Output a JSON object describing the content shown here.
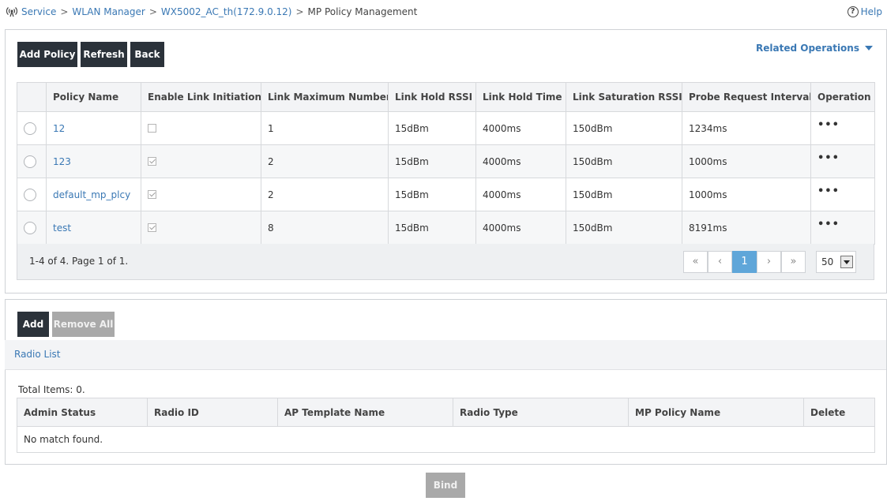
{
  "breadcrumb": {
    "items": [
      "Service",
      "WLAN Manager",
      "WX5002_AC_th(172.9.0.12)"
    ],
    "separator": ">",
    "current": "MP Policy Management"
  },
  "help": {
    "label": "Help",
    "icon": "help-circle-icon"
  },
  "toolbar": {
    "add_policy": "Add Policy",
    "refresh": "Refresh",
    "back": "Back"
  },
  "related_operations": {
    "label": "Related Operations",
    "icon": "triangle-down-icon"
  },
  "policy_table": {
    "headers": [
      "Policy Name",
      "Enable Link Initiation",
      "Link Maximum Number",
      "Link Hold RSSI",
      "Link Hold Time",
      "Link Saturation RSSI",
      "Probe Request Interval",
      "Operation"
    ],
    "rows": [
      {
        "name": "12",
        "enabled": false,
        "max": "1",
        "hold_rssi": "15dBm",
        "hold_time": "4000ms",
        "sat_rssi": "150dBm",
        "probe": "1234ms",
        "op": "•••"
      },
      {
        "name": "123",
        "enabled": true,
        "max": "2",
        "hold_rssi": "15dBm",
        "hold_time": "4000ms",
        "sat_rssi": "150dBm",
        "probe": "1000ms",
        "op": "•••"
      },
      {
        "name": "default_mp_plcy",
        "enabled": true,
        "max": "2",
        "hold_rssi": "15dBm",
        "hold_time": "4000ms",
        "sat_rssi": "150dBm",
        "probe": "1000ms",
        "op": "•••"
      },
      {
        "name": "test",
        "enabled": true,
        "max": "8",
        "hold_rssi": "15dBm",
        "hold_time": "4000ms",
        "sat_rssi": "150dBm",
        "probe": "8191ms",
        "op": "•••"
      }
    ]
  },
  "pagination": {
    "info": "1-4 of 4. Page 1 of 1.",
    "first": "«",
    "prev": "‹",
    "current_page": "1",
    "next": "›",
    "last": "»",
    "page_size": "50"
  },
  "radio_section": {
    "add": "Add",
    "remove_all": "Remove All",
    "title": "Radio List",
    "total": "Total Items: 0.",
    "headers": [
      "Admin Status",
      "Radio ID",
      "AP Template Name",
      "Radio Type",
      "MP Policy Name",
      "Delete"
    ],
    "empty": "No match found."
  },
  "bind": "Bind",
  "colors": {
    "link": "#3a78b4",
    "button": "#2b323a",
    "disabled": "#a9a9a9",
    "active_page": "#5fa6d9"
  }
}
